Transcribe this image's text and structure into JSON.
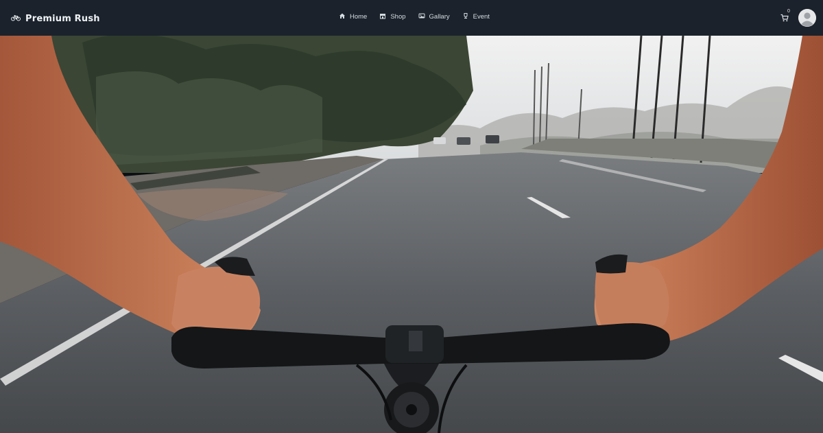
{
  "brand": {
    "name": "Premium Rush",
    "logo_icon": "bicycle-icon"
  },
  "nav": {
    "items": [
      {
        "label": "Home",
        "icon": "home-icon"
      },
      {
        "label": "Shop",
        "icon": "store-icon"
      },
      {
        "label": "Gallary",
        "icon": "image-icon"
      },
      {
        "label": "Event",
        "icon": "trophy-icon"
      }
    ]
  },
  "cart": {
    "count": "0",
    "icon": "cart-icon"
  },
  "user": {
    "icon": "user-avatar-icon"
  },
  "hero": {
    "description": "first-person bicycle handlebar view on a city road"
  },
  "colors": {
    "navbar": "#1b222b",
    "text": "#e8ecef"
  }
}
